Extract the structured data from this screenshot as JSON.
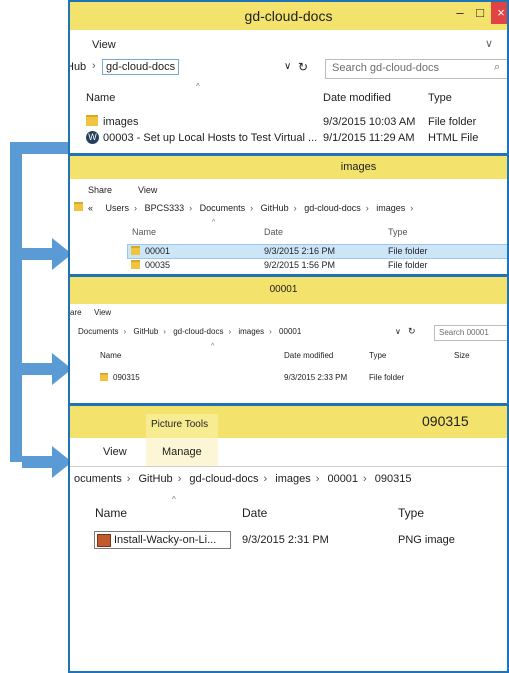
{
  "win1": {
    "title": "gd-cloud-docs",
    "menu_view": "View",
    "path": {
      "hub": "Hub",
      "current": "gd-cloud-docs"
    },
    "search_placeholder": "Search gd-cloud-docs",
    "col_name": "Name",
    "col_date": "Date modified",
    "col_type": "Type",
    "rows": [
      {
        "name": "images",
        "date": "9/3/2015 10:03 AM",
        "type": "File folder"
      },
      {
        "name": "00003 - Set up Local Hosts to Test Virtual ...",
        "date": "9/1/2015 11:29 AM",
        "type": "HTML File"
      }
    ]
  },
  "win2": {
    "title": "images",
    "menu_share": "Share",
    "menu_view": "View",
    "path": [
      "«",
      "Users",
      "BPCS333",
      "Documents",
      "GitHub",
      "gd-cloud-docs",
      "images"
    ],
    "col_name": "Name",
    "col_date": "Date",
    "col_type": "Type",
    "rows": [
      {
        "name": "00001",
        "date": "9/3/2015 2:16 PM",
        "type": "File folder"
      },
      {
        "name": "00035",
        "date": "9/2/2015 1:56 PM",
        "type": "File folder"
      }
    ]
  },
  "win3": {
    "title": "00001",
    "menu_share": "are",
    "menu_view": "View",
    "path": [
      "Documents",
      "GitHub",
      "gd-cloud-docs",
      "images",
      "00001"
    ],
    "search_placeholder": "Search 00001",
    "col_name": "Name",
    "col_date": "Date modified",
    "col_type": "Type",
    "col_size": "Size",
    "rows": [
      {
        "name": "090315",
        "date": "9/3/2015 2:33 PM",
        "type": "File folder"
      }
    ]
  },
  "win4": {
    "title": "090315",
    "tools_tab": "Picture Tools",
    "tab_view": "View",
    "tab_manage": "Manage",
    "path": [
      "ocuments",
      "GitHub",
      "gd-cloud-docs",
      "images",
      "00001",
      "090315"
    ],
    "col_name": "Name",
    "col_date": "Date",
    "col_type": "Type",
    "rows": [
      {
        "name": "Install-Wacky-on-Li...",
        "date": "9/3/2015 2:31 PM",
        "type": "PNG image"
      }
    ]
  },
  "colors": {
    "frame": "#1f74b8",
    "titlebar": "#f3e26b",
    "arrow": "#5b9bd5",
    "close": "#e04343"
  }
}
